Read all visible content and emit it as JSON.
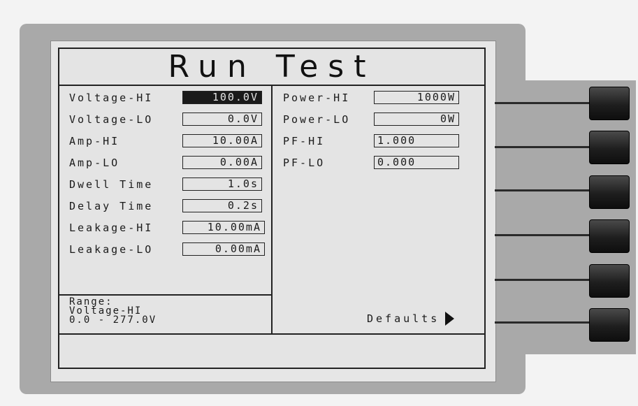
{
  "screen": {
    "title": "Run Test"
  },
  "left_params": [
    {
      "label": "Voltage-HI",
      "value": "100.0V",
      "selected": true
    },
    {
      "label": "Voltage-LO",
      "value": "0.0V",
      "selected": false
    },
    {
      "label": "Amp-HI",
      "value": "10.00A",
      "selected": false
    },
    {
      "label": "Amp-LO",
      "value": "0.00A",
      "selected": false
    },
    {
      "label": "Dwell Time",
      "value": "1.0s",
      "selected": false
    },
    {
      "label": "Delay Time",
      "value": "0.2s",
      "selected": false
    },
    {
      "label": "Leakage-HI",
      "value": "10.00mA",
      "selected": false
    },
    {
      "label": "Leakage-LO",
      "value": "0.00mA",
      "selected": false
    }
  ],
  "right_params": [
    {
      "label": "Power-HI",
      "value": "1000W"
    },
    {
      "label": "Power-LO",
      "value": "0W"
    },
    {
      "label": "PF-HI",
      "value": "1.000"
    },
    {
      "label": "PF-LO",
      "value": "0.000"
    }
  ],
  "range_info": {
    "heading": "Range:",
    "param": "Voltage-HI",
    "span": "0.0 - 277.0V"
  },
  "softkeys": {
    "defaults_label": "Defaults"
  },
  "colors": {
    "lcd_bg": "#e4e4e4",
    "bezel": "#a9a9a9",
    "ink": "#1a1a1a"
  }
}
